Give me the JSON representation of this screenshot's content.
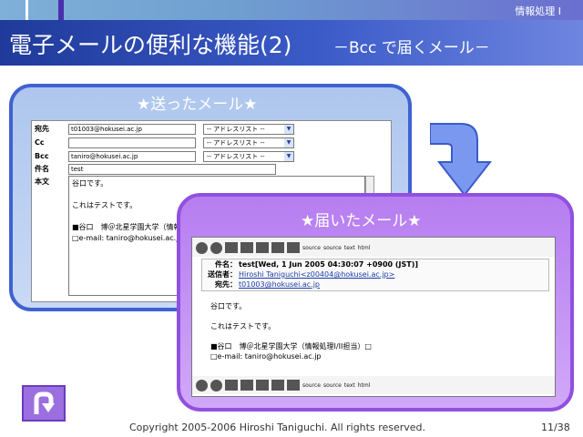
{
  "header": {
    "course": "情報処理 I",
    "title": "電子メールの便利な機能(2)",
    "subtitle": "－Bcc で届くメール－"
  },
  "sent": {
    "heading": "★送ったメール★",
    "fields": [
      {
        "label": "宛先",
        "value": "t01003@hokusei.ac.jp",
        "select": "-- アドレスリスト --"
      },
      {
        "label": "Cc",
        "value": "",
        "select": "-- アドレスリスト --"
      },
      {
        "label": "Bcc",
        "value": "taniro@hokusei.ac.jp",
        "select": "-- アドレスリスト --"
      },
      {
        "label": "件名",
        "value": "test"
      }
    ],
    "body_label": "本文",
    "body_lines": [
      "谷口です。",
      "",
      "これはテストです。",
      "",
      "■谷口　博＠北星学園大学（情報処理I/II担当）□",
      "□e-mail: taniro@hokusei.ac.jp"
    ]
  },
  "received": {
    "heading": "★届いたメール★",
    "toolbar_labels": [
      "source",
      "source",
      "text",
      "html"
    ],
    "headers": [
      {
        "label": "件名：",
        "value": "test[Wed, 1 Jun 2005 04:30:07 +0900 (JST)]"
      },
      {
        "label": "送信者：",
        "value": "Hiroshi Taniguchi<z00404@hokusei.ac.jp>"
      },
      {
        "label": "宛先：",
        "value": "t01003@hokusei.ac.jp"
      }
    ],
    "body_lines": [
      "谷口です。",
      "",
      "これはテストです。",
      "",
      "■谷口　博＠北星学園大学（情報処理I/II担当）□",
      "□e-mail: taniro@hokusei.ac.jp"
    ],
    "body_link": "taniro@hokusei.ac.jp"
  },
  "footer": {
    "copyright": "Copyright 2005-2006 Hiroshi Taniguchi. All rights reserved.",
    "page": "11/38"
  },
  "colors": {
    "title_bar": "#1f3a9a",
    "sent_panel": "#3f62d0",
    "recv_panel": "#9050e0",
    "arrow": "#6a8cf0"
  },
  "icons": {
    "back_button": "u-turn-arrow-icon",
    "arrow": "curved-down-arrow-icon"
  }
}
